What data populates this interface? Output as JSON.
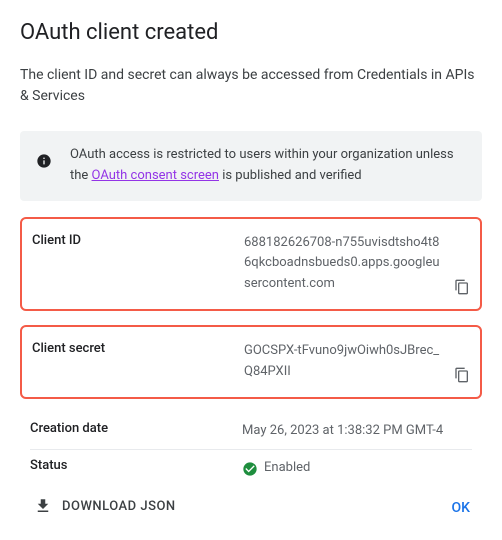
{
  "title": "OAuth client created",
  "subtitle": "The client ID and secret can always be accessed from Credentials in APIs & Services",
  "info": {
    "prefix": "OAuth access is restricted to users within your organization unless the ",
    "link": "OAuth consent screen",
    "suffix": " is published and verified"
  },
  "client_id": {
    "label": "Client ID",
    "value": "688182626708-n755uvisdtsho4t86qkcboadnsbueds0.apps.googleusercontent.com"
  },
  "client_secret": {
    "label": "Client secret",
    "value": "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"
  },
  "creation_date": {
    "label": "Creation date",
    "value": "May 26, 2023 at 1:38:32 PM GMT-4"
  },
  "status": {
    "label": "Status",
    "value": "Enabled"
  },
  "download_label": "DOWNLOAD JSON",
  "ok_label": "OK"
}
